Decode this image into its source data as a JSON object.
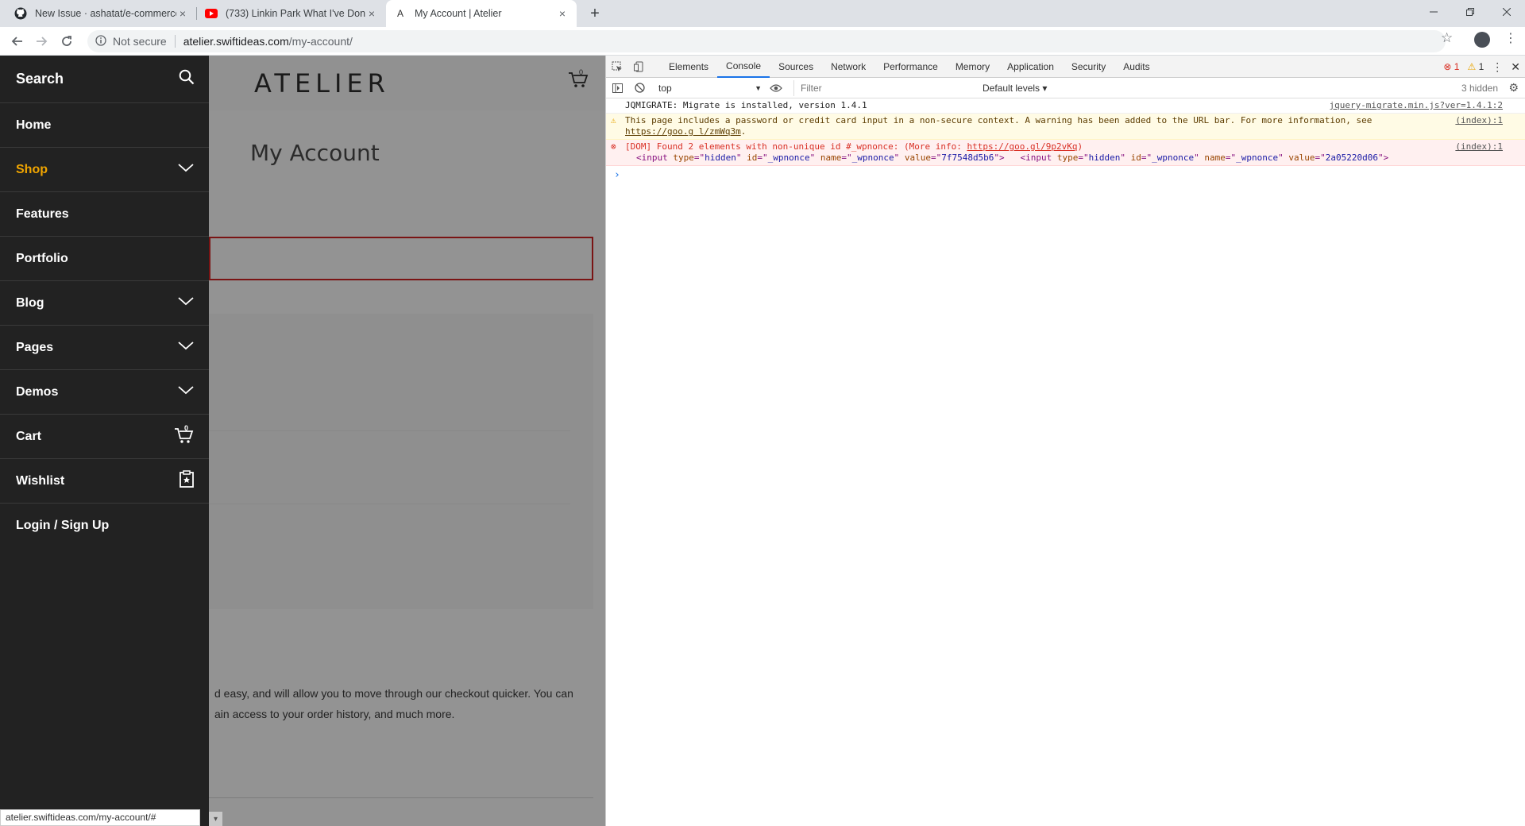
{
  "browser": {
    "tabs": [
      {
        "title": "New Issue · ashatat/e-commerce",
        "icon": "github-icon",
        "active": false
      },
      {
        "title": "(733) Linkin Park What I've Done",
        "icon": "youtube-icon",
        "active": false
      },
      {
        "title": "My Account | Atelier",
        "icon": "atelier-icon",
        "active": true
      }
    ],
    "tab_close": "×",
    "new_tab": "+",
    "address": {
      "security": "Not secure",
      "host": "atelier.swiftideas.com",
      "path": "/my-account/"
    },
    "status_url": "atelier.swiftideas.com/my-account/#"
  },
  "page": {
    "logo": "ATELIER",
    "cart_count": "0",
    "title": "My Account",
    "intro_line1": "d easy, and will allow you to move through our checkout quicker. You can",
    "intro_line2": "ain access to your order history, and much more."
  },
  "sidemenu": {
    "search": "Search",
    "items": [
      {
        "label": "Home",
        "chevron": false,
        "active": false
      },
      {
        "label": "Shop",
        "chevron": true,
        "active": true
      },
      {
        "label": "Features",
        "chevron": false,
        "active": false
      },
      {
        "label": "Portfolio",
        "chevron": false,
        "active": false
      },
      {
        "label": "Blog",
        "chevron": true,
        "active": false
      },
      {
        "label": "Pages",
        "chevron": true,
        "active": false
      },
      {
        "label": "Demos",
        "chevron": true,
        "active": false
      }
    ],
    "cart": {
      "label": "Cart",
      "count": "0"
    },
    "wishlist": {
      "label": "Wishlist"
    },
    "login": {
      "label": "Login / Sign Up"
    },
    "accent": "#f0a500"
  },
  "devtools": {
    "tabs": [
      "Elements",
      "Console",
      "Sources",
      "Network",
      "Performance",
      "Memory",
      "Application",
      "Security",
      "Audits"
    ],
    "active_tab": "Console",
    "error_count": "1",
    "warning_count": "1",
    "context": "top",
    "filter_placeholder": "Filter",
    "levels": "Default levels ▾",
    "hidden": "3 hidden",
    "messages": {
      "info": {
        "text": "JQMIGRATE: Migrate is installed, version 1.4.1",
        "source": "jquery-migrate.min.js?ver=1.4.1:2"
      },
      "warning": {
        "text": "This page includes a password or credit card input in a non-secure context. A warning has been added to the URL bar. For more information, see ",
        "link": "https://goo.g l/zmWq3m",
        "end": ".",
        "source": "(index):1"
      },
      "error": {
        "text": "[DOM] Found 2 elements with non-unique id #_wpnonce: (More info: ",
        "link": "https://goo.gl/9p2vKq",
        "end": ")",
        "source": "(index):1",
        "input1_value": "7f7548d5b6",
        "input2_value": "2a05220d06"
      }
    },
    "prompt": "›"
  }
}
